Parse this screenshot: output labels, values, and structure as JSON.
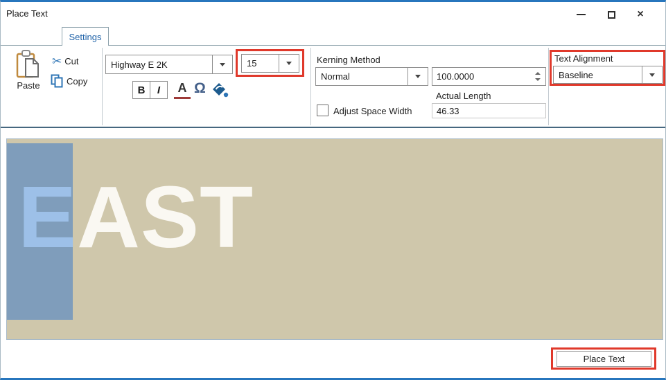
{
  "window": {
    "title": "Place Text",
    "close_glyph": "×"
  },
  "tabs": {
    "settings": "Settings"
  },
  "ribbon": {
    "clipboard": {
      "paste": "Paste",
      "cut": "Cut",
      "copy": "Copy"
    },
    "font": {
      "family": "Highway E 2K",
      "size": "15",
      "bold": "B",
      "italic": "I",
      "underline": "A",
      "symbol": "Ω"
    },
    "kerning": {
      "label": "Kerning Method",
      "method": "Normal",
      "spacing": "100.0000",
      "adjust_space_width": "Adjust Space Width",
      "actual_length_label": "Actual Length",
      "actual_length": "46.33"
    },
    "alignment": {
      "label": "Text Alignment",
      "value": "Baseline"
    }
  },
  "preview": {
    "selected_text": "E",
    "remaining_text": "AST",
    "full_text": "EAST"
  },
  "footer": {
    "place_text": "Place Text"
  },
  "colors": {
    "highlight_red": "#e0392b",
    "window_border_blue": "#2776bd",
    "tab_text_blue": "#1f62a8",
    "canvas_tan": "#cfc7ab",
    "selection_blue": "#7f9dbb",
    "selected_letter_blue": "#9dc0e8",
    "text_white": "#faf8f2",
    "icon_blue": "#2e75b6"
  }
}
